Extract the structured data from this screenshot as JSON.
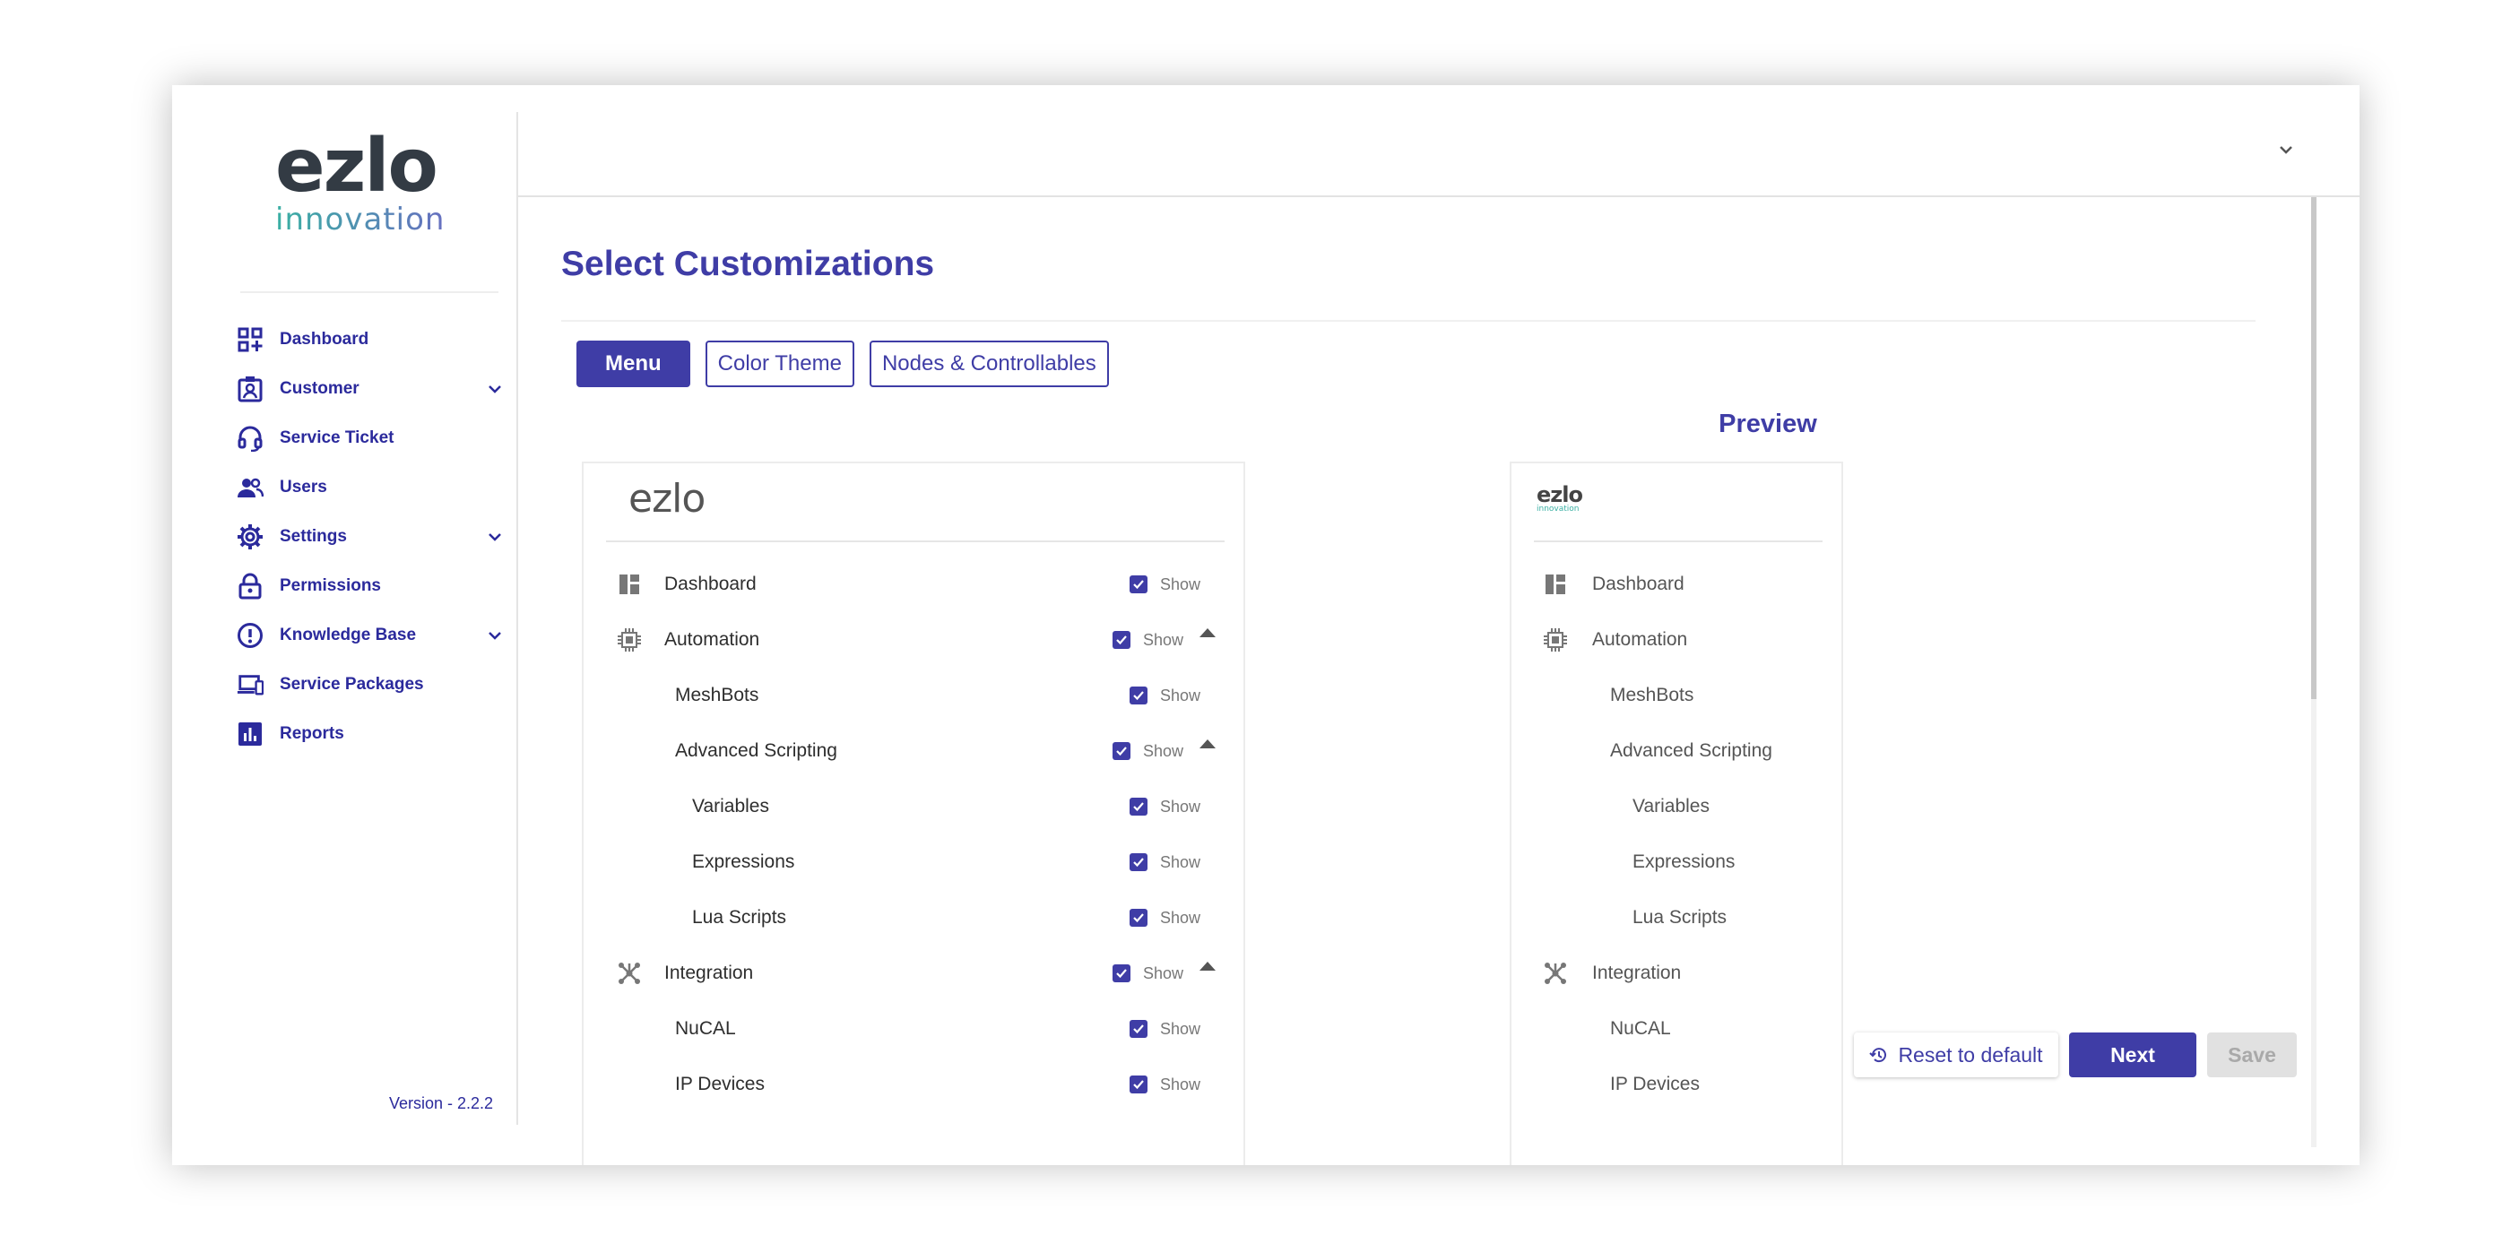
{
  "brand": {
    "logo_main": "ezlo",
    "logo_sub": "innovation",
    "accent": "#3f3da6",
    "nav_color": "#2b2a9c"
  },
  "sidebar": {
    "items": [
      {
        "label": "Dashboard",
        "icon": "dashboard-icon",
        "expandable": false
      },
      {
        "label": "Customer",
        "icon": "customer-icon",
        "expandable": true
      },
      {
        "label": "Service Ticket",
        "icon": "headset-icon",
        "expandable": false
      },
      {
        "label": "Users",
        "icon": "users-icon",
        "expandable": false
      },
      {
        "label": "Settings",
        "icon": "gear-icon",
        "expandable": true
      },
      {
        "label": "Permissions",
        "icon": "lock-icon",
        "expandable": false
      },
      {
        "label": "Knowledge Base",
        "icon": "info-icon",
        "expandable": true
      },
      {
        "label": "Service Packages",
        "icon": "devices-icon",
        "expandable": false
      },
      {
        "label": "Reports",
        "icon": "chart-icon",
        "expandable": false
      }
    ],
    "version": "Version - 2.2.2"
  },
  "main": {
    "title": "Select Customizations",
    "tabs": [
      {
        "label": "Menu",
        "active": true
      },
      {
        "label": "Color Theme",
        "active": false
      },
      {
        "label": "Nodes & Controllables",
        "active": false
      }
    ],
    "preview_title": "Preview",
    "panel_logo": "ezlo",
    "preview_logo_main": "ezlo",
    "preview_logo_sub": "innovation",
    "show_label": "Show",
    "menu_items": [
      {
        "label": "Dashboard",
        "icon": "dashboard-icon",
        "level": 0,
        "checked": true,
        "collapsible": false
      },
      {
        "label": "Automation",
        "icon": "chip-icon",
        "level": 0,
        "checked": true,
        "collapsible": true
      },
      {
        "label": "MeshBots",
        "level": 1,
        "checked": true,
        "collapsible": false
      },
      {
        "label": "Advanced Scripting",
        "level": 1,
        "checked": true,
        "collapsible": true
      },
      {
        "label": "Variables",
        "level": 2,
        "checked": true,
        "collapsible": false
      },
      {
        "label": "Expressions",
        "level": 2,
        "checked": true,
        "collapsible": false
      },
      {
        "label": "Lua Scripts",
        "level": 2,
        "checked": true,
        "collapsible": false
      },
      {
        "label": "Integration",
        "icon": "integration-icon",
        "level": 0,
        "checked": true,
        "collapsible": true
      },
      {
        "label": "NuCAL",
        "level": 1,
        "checked": true,
        "collapsible": false
      },
      {
        "label": "IP Devices",
        "level": 1,
        "checked": true,
        "collapsible": false
      }
    ],
    "buttons": {
      "reset": "Reset to default",
      "next": "Next",
      "save": "Save"
    }
  }
}
